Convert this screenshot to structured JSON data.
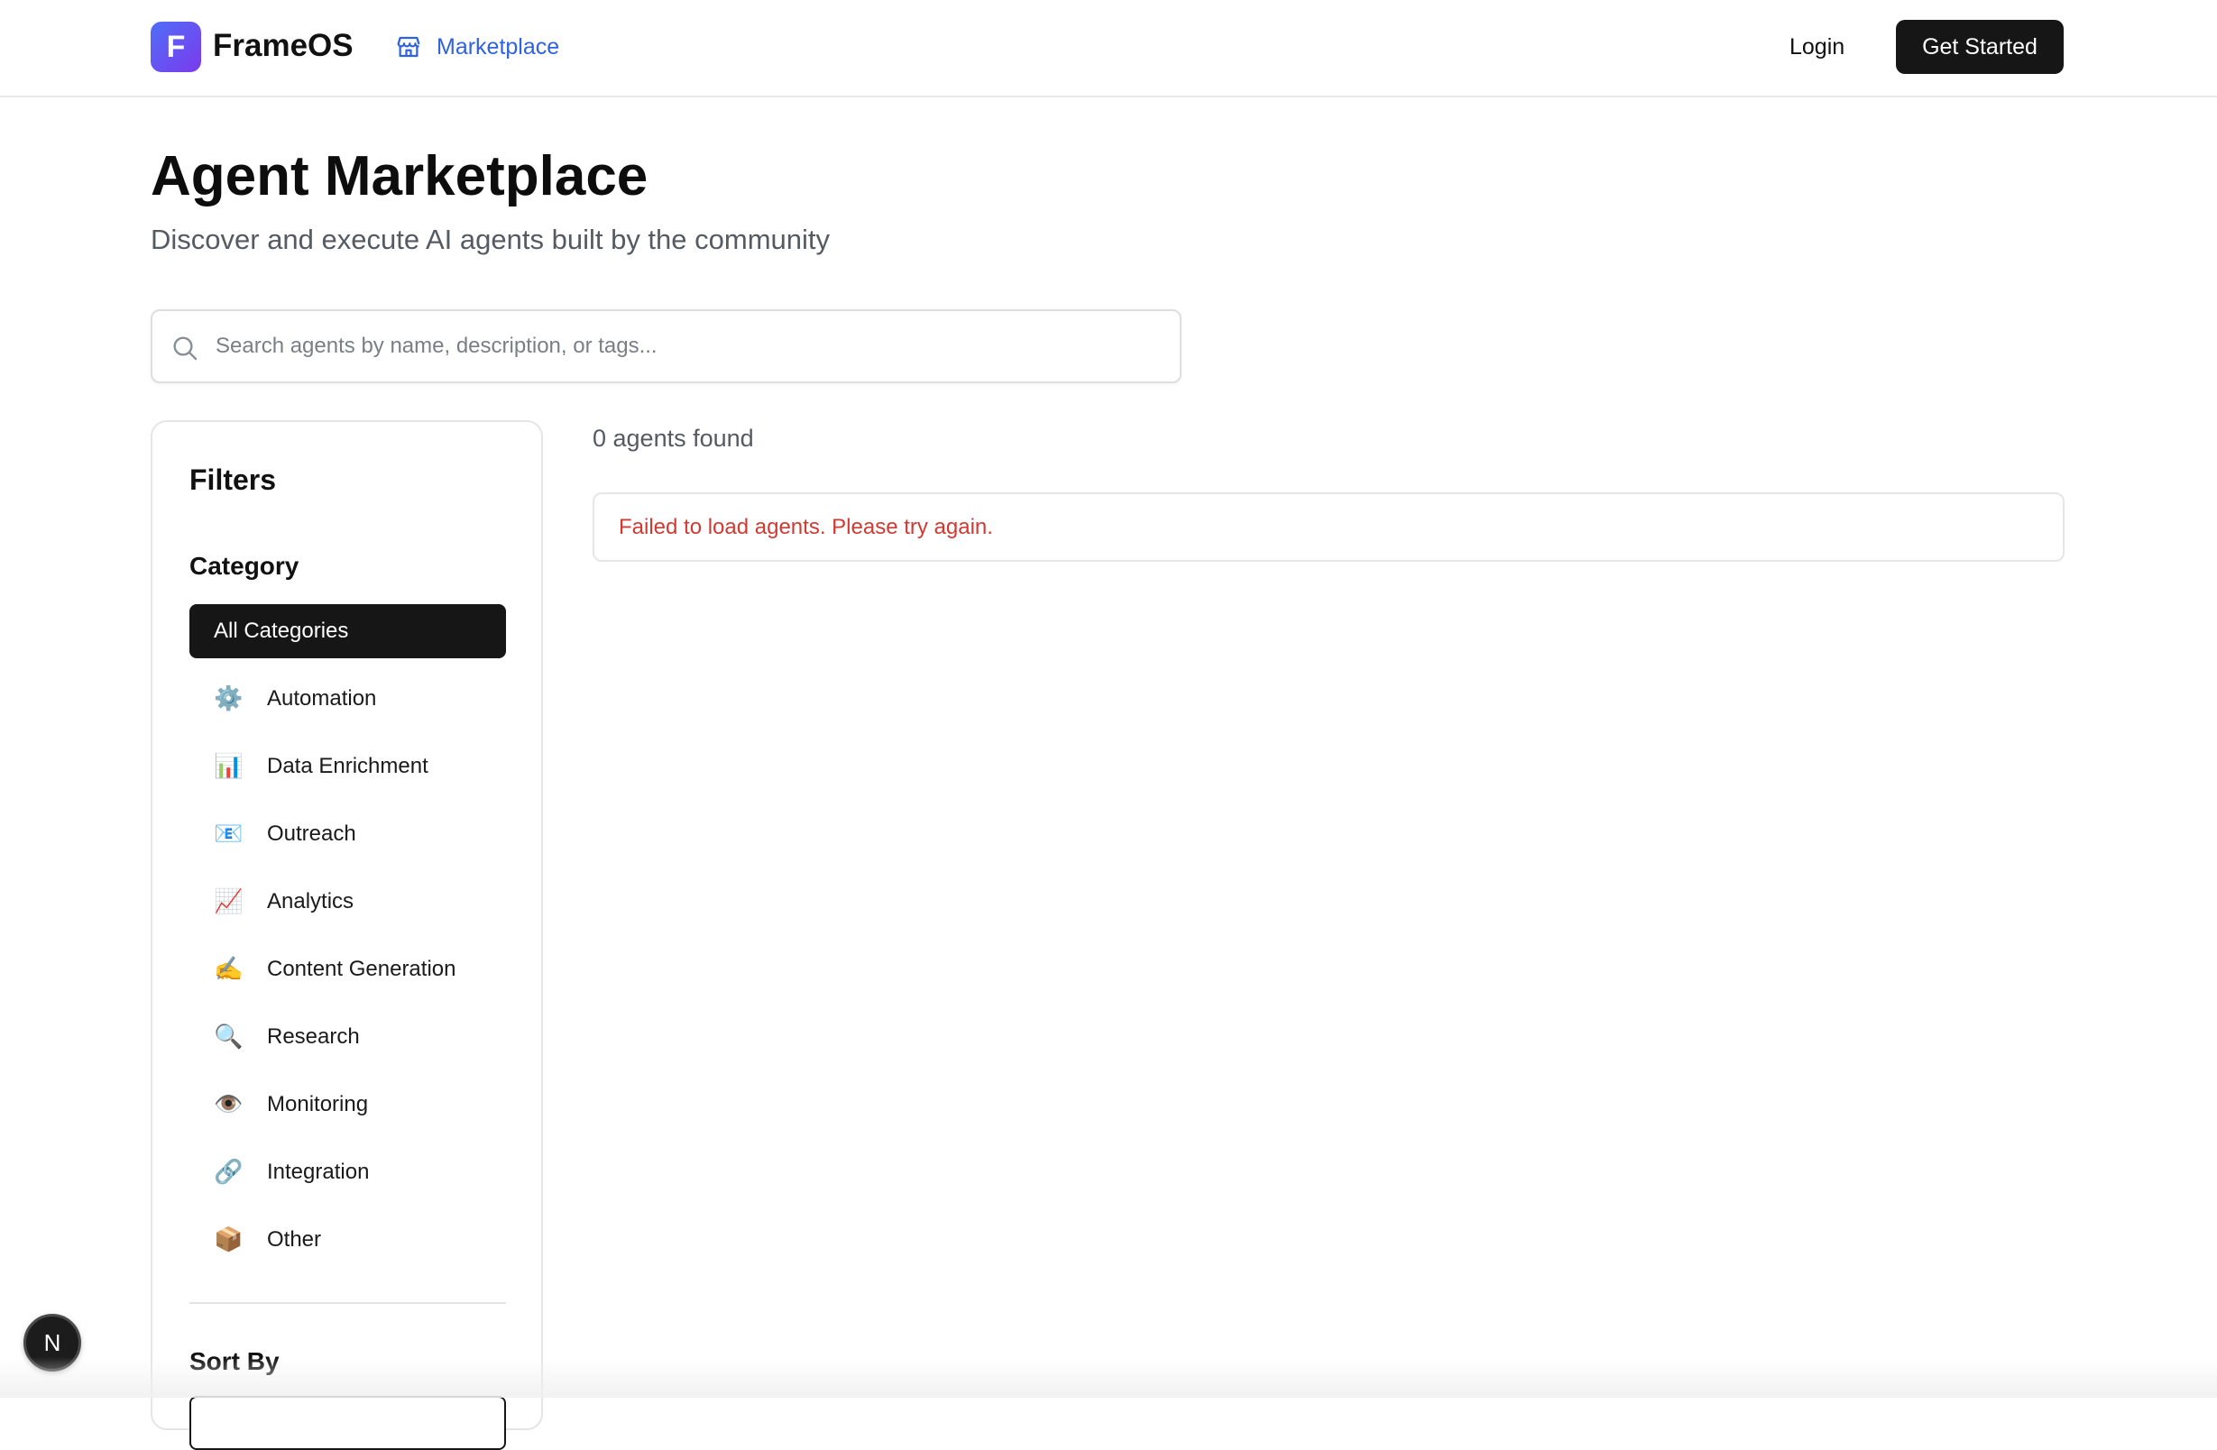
{
  "header": {
    "logo_letter": "F",
    "brand": "FrameOS",
    "nav_marketplace": "Marketplace",
    "login": "Login",
    "get_started": "Get Started"
  },
  "page": {
    "title": "Agent Marketplace",
    "subtitle": "Discover and execute AI agents built by the community"
  },
  "search": {
    "placeholder": "Search agents by name, description, or tags...",
    "value": ""
  },
  "filters": {
    "title": "Filters",
    "category_heading": "Category",
    "categories": [
      {
        "label": "All Categories",
        "icon": "",
        "active": true
      },
      {
        "label": "Automation",
        "icon": "⚙️",
        "active": false
      },
      {
        "label": "Data Enrichment",
        "icon": "📊",
        "active": false
      },
      {
        "label": "Outreach",
        "icon": "📧",
        "active": false
      },
      {
        "label": "Analytics",
        "icon": "📈",
        "active": false
      },
      {
        "label": "Content Generation",
        "icon": "✍️",
        "active": false
      },
      {
        "label": "Research",
        "icon": "🔍",
        "active": false
      },
      {
        "label": "Monitoring",
        "icon": "👁️",
        "active": false
      },
      {
        "label": "Integration",
        "icon": "🔗",
        "active": false
      },
      {
        "label": "Other",
        "icon": "📦",
        "active": false
      }
    ],
    "sort_heading": "Sort By"
  },
  "results": {
    "count_text": "0 agents found",
    "error_text": "Failed to load agents. Please try again."
  },
  "dev_badge": {
    "letter": "N"
  },
  "colors": {
    "accent_link": "#2f62e0",
    "primary_button": "#161616",
    "error_text": "#d13a32",
    "logo_gradient_start": "#4f6ef7",
    "logo_gradient_end": "#7c3aed"
  }
}
